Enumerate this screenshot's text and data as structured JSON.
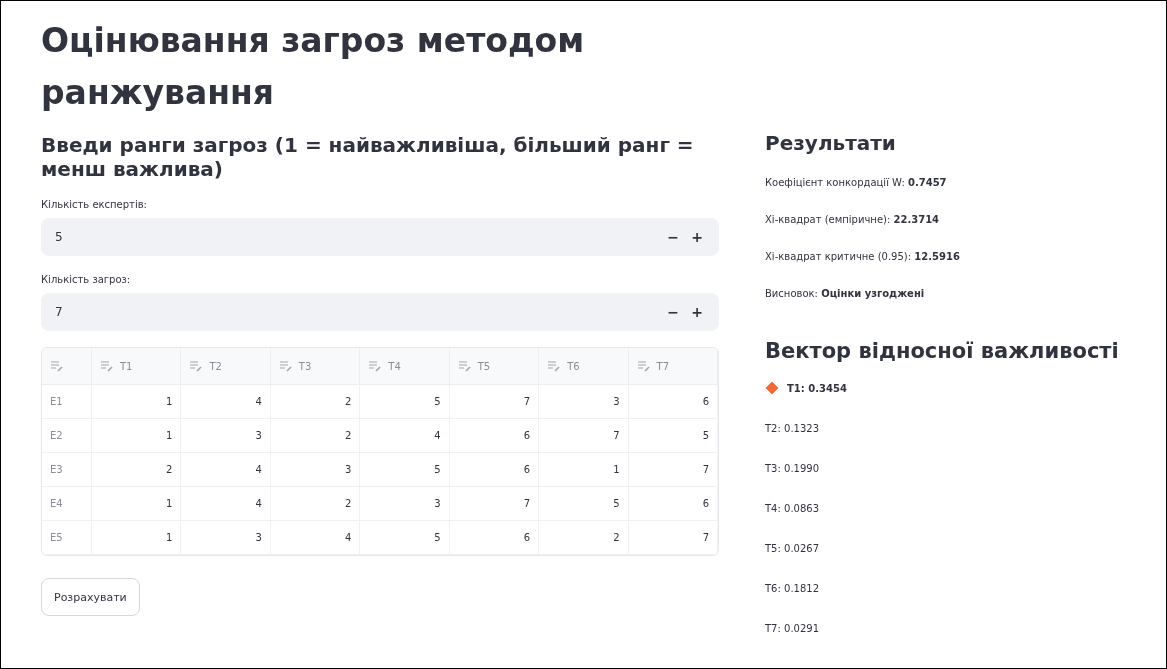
{
  "title": "Оцінювання загроз методом ранжування",
  "input_section": {
    "heading": "Введи ранги загроз (1 = найважливіша, більший ранг = менш важлива)",
    "fields": [
      {
        "label": "Кількість експертів:",
        "value": "5",
        "minus": "−",
        "plus": "+"
      },
      {
        "label": "Кількість загроз:",
        "value": "7",
        "minus": "−",
        "plus": "+"
      }
    ],
    "table": {
      "columns": [
        "T1",
        "T2",
        "T3",
        "T4",
        "T5",
        "T6",
        "T7"
      ],
      "rows": [
        {
          "label": "E1",
          "values": [
            "1",
            "4",
            "2",
            "5",
            "7",
            "3",
            "6"
          ]
        },
        {
          "label": "E2",
          "values": [
            "1",
            "3",
            "2",
            "4",
            "6",
            "7",
            "5"
          ]
        },
        {
          "label": "E3",
          "values": [
            "2",
            "4",
            "3",
            "5",
            "6",
            "1",
            "7"
          ]
        },
        {
          "label": "E4",
          "values": [
            "1",
            "4",
            "2",
            "3",
            "7",
            "5",
            "6"
          ]
        },
        {
          "label": "E5",
          "values": [
            "1",
            "3",
            "4",
            "5",
            "6",
            "2",
            "7"
          ]
        }
      ]
    },
    "button": "Розрахувати"
  },
  "results": {
    "heading": "Результати",
    "lines": [
      "Коефіцієнт конкордації W: **0.7457**",
      "Хі-квадрат (емпіричне): **22.3714**",
      "Хі-квадрат критичне (0.95): **12.5916**",
      "Висновок: **Оцінки узгоджені**"
    ]
  },
  "vector": {
    "heading": "Вектор відносної важливості",
    "items": [
      {
        "text": "T1: 0.3454",
        "highlighted": true
      },
      {
        "text": "T2: 0.1323",
        "highlighted": false
      },
      {
        "text": "T3: 0.1990",
        "highlighted": false
      },
      {
        "text": "T4: 0.0863",
        "highlighted": false
      },
      {
        "text": "T5: 0.0267",
        "highlighted": false
      },
      {
        "text": "T6: 0.1812",
        "highlighted": false
      },
      {
        "text": "T7: 0.0291",
        "highlighted": false
      }
    ]
  }
}
